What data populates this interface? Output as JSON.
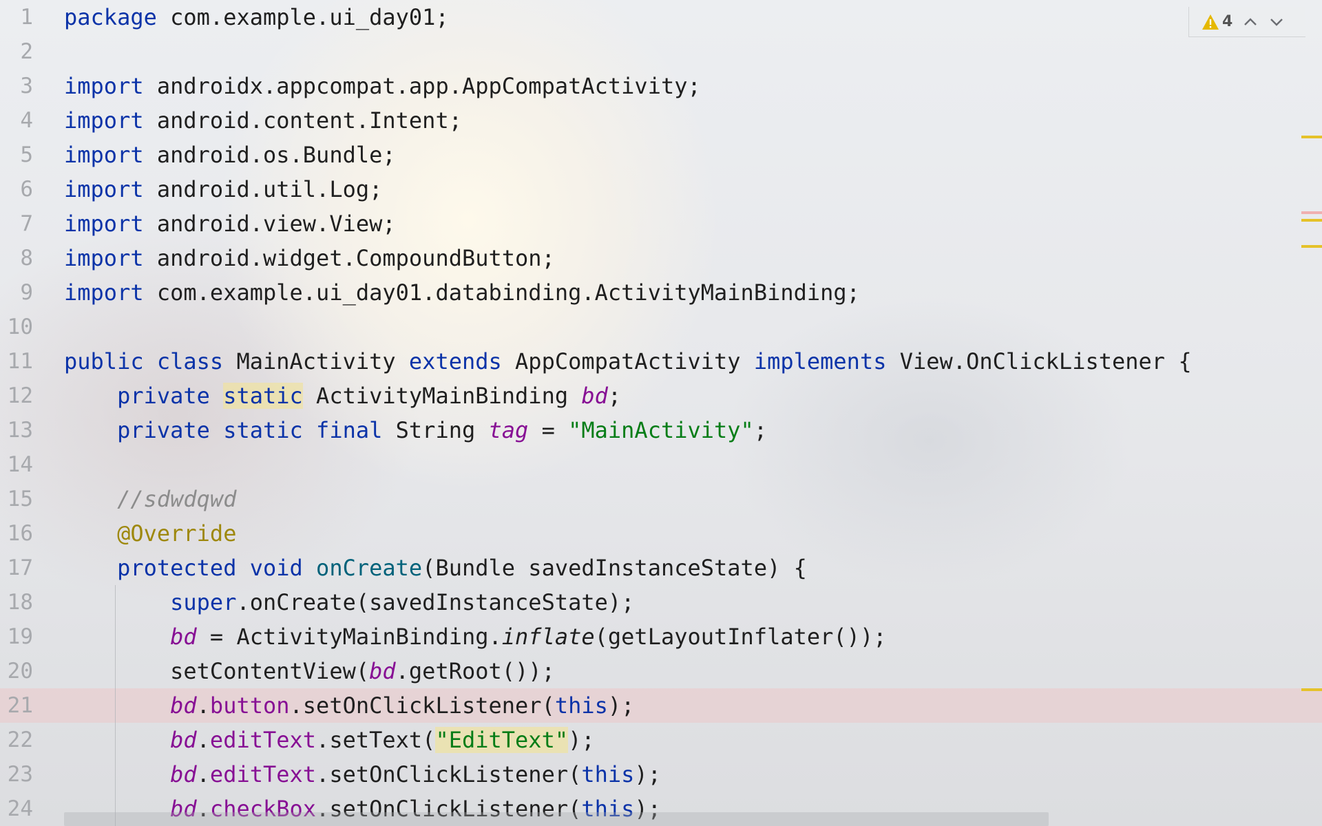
{
  "inspection": {
    "warning_count": "4",
    "warning_icon": "warning-triangle-icon",
    "prev_icon": "chevron-up-icon",
    "next_icon": "chevron-down-icon",
    "warning_color": "#e5b800"
  },
  "editor": {
    "current_line": "21",
    "lines": [
      {
        "num": "1",
        "segments": [
          {
            "t": "package",
            "c": "kw"
          },
          {
            "t": " com.example.ui_day01;"
          }
        ]
      },
      {
        "num": "2",
        "segments": []
      },
      {
        "num": "3",
        "segments": [
          {
            "t": "import",
            "c": "kw"
          },
          {
            "t": " androidx.appcompat.app.AppCompatActivity;"
          }
        ]
      },
      {
        "num": "4",
        "segments": [
          {
            "t": "import",
            "c": "kw"
          },
          {
            "t": " android.content.Intent;"
          }
        ]
      },
      {
        "num": "5",
        "segments": [
          {
            "t": "import",
            "c": "kw"
          },
          {
            "t": " android.os.Bundle;"
          }
        ]
      },
      {
        "num": "6",
        "segments": [
          {
            "t": "import",
            "c": "kw"
          },
          {
            "t": " android.util.Log;"
          }
        ]
      },
      {
        "num": "7",
        "segments": [
          {
            "t": "import",
            "c": "kw"
          },
          {
            "t": " android.view.View;"
          }
        ]
      },
      {
        "num": "8",
        "segments": [
          {
            "t": "import",
            "c": "kw"
          },
          {
            "t": " android.widget.CompoundButton;"
          }
        ]
      },
      {
        "num": "9",
        "segments": [
          {
            "t": "import",
            "c": "kw"
          },
          {
            "t": " com.example.ui_day01.databinding.ActivityMainBinding;"
          }
        ]
      },
      {
        "num": "10",
        "segments": []
      },
      {
        "num": "11",
        "segments": [
          {
            "t": "public class",
            "c": "kw"
          },
          {
            "t": " MainActivity "
          },
          {
            "t": "extends",
            "c": "kw"
          },
          {
            "t": " AppCompatActivity "
          },
          {
            "t": "implements",
            "c": "kw"
          },
          {
            "t": " View.OnClickListener {"
          }
        ]
      },
      {
        "num": "12",
        "segments": [
          {
            "t": "    "
          },
          {
            "t": "private",
            "c": "kw"
          },
          {
            "t": " "
          },
          {
            "t": "static",
            "c": "kw hl-yellow"
          },
          {
            "t": " ActivityMainBinding "
          },
          {
            "t": "bd",
            "c": "fld"
          },
          {
            "t": ";"
          }
        ]
      },
      {
        "num": "13",
        "segments": [
          {
            "t": "    "
          },
          {
            "t": "private static final",
            "c": "kw"
          },
          {
            "t": " String "
          },
          {
            "t": "tag",
            "c": "fld"
          },
          {
            "t": " = "
          },
          {
            "t": "\"MainActivity\"",
            "c": "str"
          },
          {
            "t": ";"
          }
        ]
      },
      {
        "num": "14",
        "segments": []
      },
      {
        "num": "15",
        "segments": [
          {
            "t": "    "
          },
          {
            "t": "//sdwdqwd",
            "c": "cmt"
          }
        ]
      },
      {
        "num": "16",
        "segments": [
          {
            "t": "    "
          },
          {
            "t": "@Override",
            "c": "ann"
          }
        ]
      },
      {
        "num": "17",
        "segments": [
          {
            "t": "    "
          },
          {
            "t": "protected void",
            "c": "kw"
          },
          {
            "t": " "
          },
          {
            "t": "onCreate",
            "c": "fn"
          },
          {
            "t": "(Bundle savedInstanceState) {"
          }
        ]
      },
      {
        "num": "18",
        "segments": [
          {
            "t": "        "
          },
          {
            "t": "super",
            "c": "kw"
          },
          {
            "t": ".onCreate(savedInstanceState);"
          }
        ]
      },
      {
        "num": "19",
        "segments": [
          {
            "t": "        "
          },
          {
            "t": "bd",
            "c": "fld"
          },
          {
            "t": " = ActivityMainBinding."
          },
          {
            "t": "inflate",
            "c": "ital"
          },
          {
            "t": "(getLayoutInflater());"
          }
        ]
      },
      {
        "num": "20",
        "segments": [
          {
            "t": "        "
          },
          {
            "t": "setContentView("
          },
          {
            "t": "bd",
            "c": "fld"
          },
          {
            "t": ".getRoot());"
          }
        ]
      },
      {
        "num": "21",
        "segments": [
          {
            "t": "        "
          },
          {
            "t": "bd",
            "c": "fld"
          },
          {
            "t": "."
          },
          {
            "t": "button",
            "c": "mem"
          },
          {
            "t": ".setOnClickListener("
          },
          {
            "t": "this",
            "c": "kw"
          },
          {
            "t": ");"
          }
        ]
      },
      {
        "num": "22",
        "segments": [
          {
            "t": "        "
          },
          {
            "t": "bd",
            "c": "fld"
          },
          {
            "t": "."
          },
          {
            "t": "editText",
            "c": "mem"
          },
          {
            "t": ".setText("
          },
          {
            "t": "\"EditText\"",
            "c": "str hl-yellow"
          },
          {
            "t": ");"
          }
        ]
      },
      {
        "num": "23",
        "segments": [
          {
            "t": "        "
          },
          {
            "t": "bd",
            "c": "fld"
          },
          {
            "t": "."
          },
          {
            "t": "editText",
            "c": "mem"
          },
          {
            "t": ".setOnClickListener("
          },
          {
            "t": "this",
            "c": "kw"
          },
          {
            "t": ");"
          }
        ]
      },
      {
        "num": "24",
        "segments": [
          {
            "t": "        "
          },
          {
            "t": "bd",
            "c": "fld"
          },
          {
            "t": "."
          },
          {
            "t": "checkBox",
            "c": "mem"
          },
          {
            "t": ".setOnClickListener("
          },
          {
            "t": "this",
            "c": "kw"
          },
          {
            "t": ");"
          }
        ]
      }
    ]
  },
  "scrollbar": {
    "marks": [
      {
        "color": "#e5c22a",
        "kind": "warning"
      },
      {
        "color": "#f0b0b0",
        "kind": "current-line"
      },
      {
        "color": "#e5c22a",
        "kind": "warning"
      },
      {
        "color": "#e5c22a",
        "kind": "warning"
      },
      {
        "color": "#e5c22a",
        "kind": "warning"
      }
    ]
  }
}
